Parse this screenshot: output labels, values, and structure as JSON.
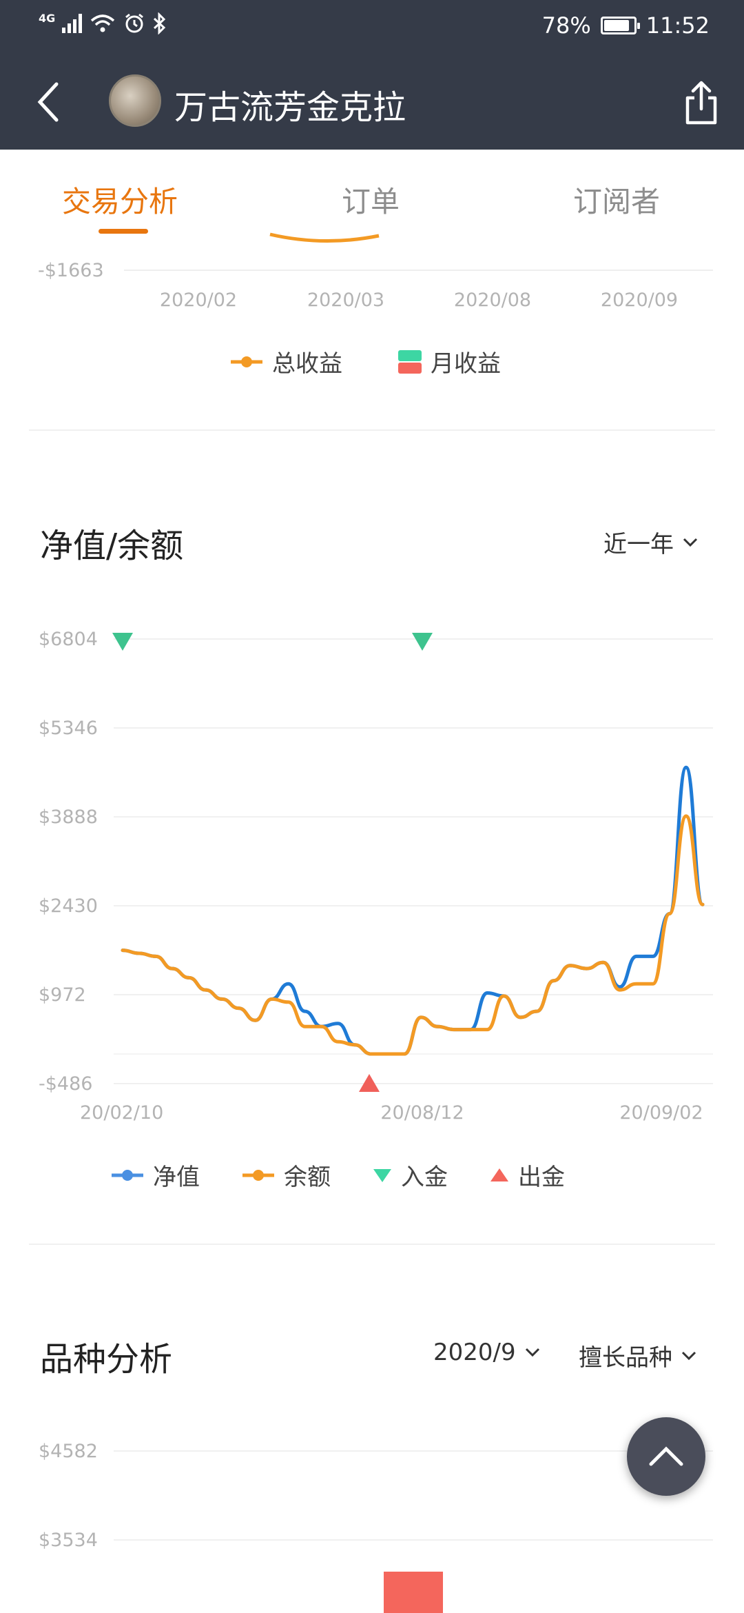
{
  "status_bar": {
    "network": "4G",
    "battery": "78%",
    "time": "11:52"
  },
  "header": {
    "title": "万古流芳金克拉"
  },
  "tabs": [
    {
      "label": "交易分析",
      "active": true
    },
    {
      "label": "订单",
      "active": false
    },
    {
      "label": "订阅者",
      "active": false
    }
  ],
  "top_chart": {
    "y_min_label": "-$1663",
    "x_labels": [
      "2020/02",
      "2020/03",
      "2020/08",
      "2020/09"
    ],
    "legend": [
      "总收益",
      "月收益"
    ],
    "colors": {
      "total": "#f39a24",
      "month_up": "#3dd6a3",
      "month_down": "#f4665c"
    }
  },
  "nav_section": {
    "title": "净值/余额",
    "range_select": "近一年"
  },
  "chart_data": {
    "type": "line",
    "y_ticks": [
      "$6804",
      "$5346",
      "$3888",
      "$2430",
      "$972",
      "-$486"
    ],
    "ylim": [
      -486,
      6804
    ],
    "x_labels": [
      "20/02/10",
      "20/08/12",
      "20/09/02"
    ],
    "series": [
      {
        "name": "净值",
        "color": "#1f7bd6",
        "values": [
          1700,
          1650,
          1600,
          1400,
          1250,
          1050,
          900,
          750,
          550,
          900,
          1150,
          700,
          450,
          500,
          150,
          0,
          0,
          0,
          600,
          450,
          400,
          400,
          1000,
          950,
          600,
          700,
          1200,
          1450,
          1400,
          1500,
          1100,
          1600,
          1600,
          2300,
          4700,
          2450
        ]
      },
      {
        "name": "余额",
        "color": "#f39a24",
        "values": [
          1700,
          1650,
          1600,
          1400,
          1250,
          1050,
          900,
          750,
          550,
          900,
          850,
          450,
          450,
          200,
          150,
          0,
          0,
          0,
          600,
          450,
          400,
          400,
          400,
          950,
          600,
          700,
          1200,
          1450,
          1400,
          1500,
          1050,
          1150,
          1150,
          2300,
          3900,
          2450
        ]
      }
    ],
    "markers": {
      "deposit_label": "入金",
      "withdraw_label": "出金",
      "deposit_color": "#3ec38e",
      "withdraw_color": "#f0605a"
    }
  },
  "nav_legend": [
    "净值",
    "余额",
    "入金",
    "出金"
  ],
  "variety_section": {
    "title": "品种分析",
    "date_select": "2020/9",
    "type_select": "擅长品种",
    "y_ticks": [
      "$4582",
      "$3534"
    ],
    "bar_color": "#f4665c"
  }
}
